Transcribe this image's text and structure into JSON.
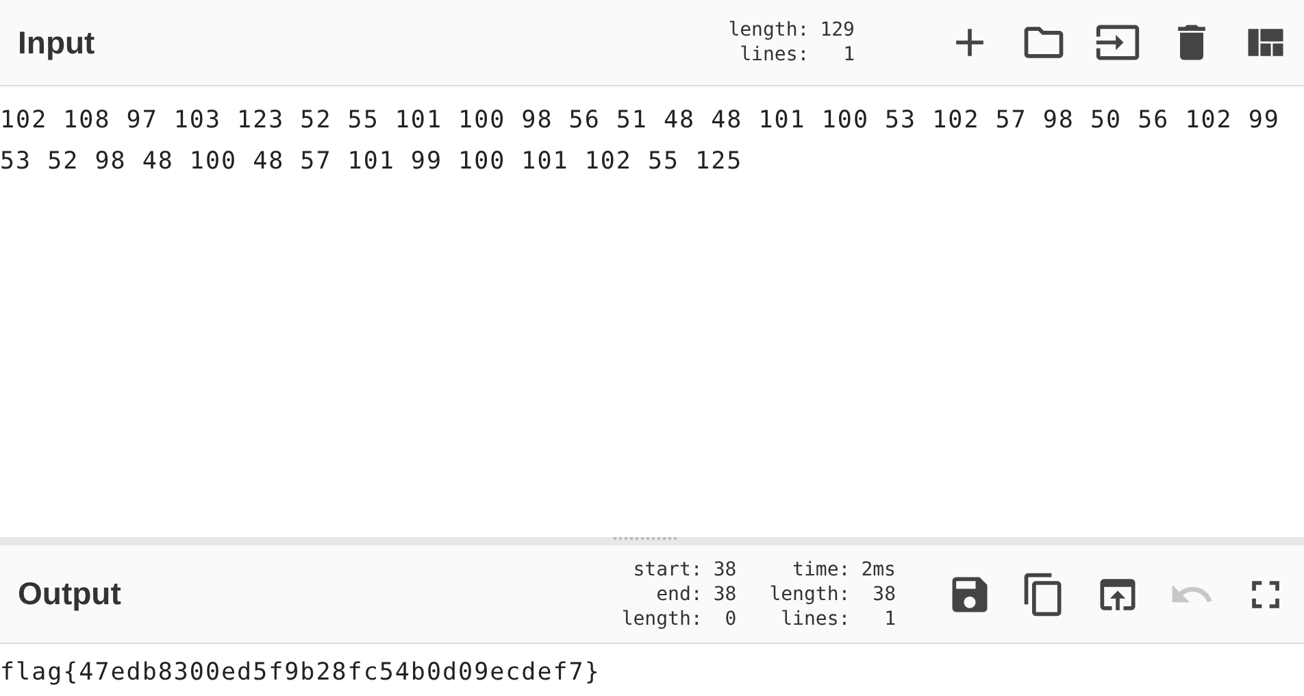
{
  "input": {
    "title": "Input",
    "stats": [
      {
        "label": "length:",
        "value": "129"
      },
      {
        "label": "lines:",
        "value": "1"
      }
    ],
    "buttons": [
      {
        "kind": "add",
        "disabled": false
      },
      {
        "kind": "open",
        "disabled": false
      },
      {
        "kind": "insert",
        "disabled": false
      },
      {
        "kind": "delete",
        "disabled": false
      },
      {
        "kind": "layout",
        "disabled": false
      }
    ],
    "text": "102 108 97 103 123 52 55 101 100 98 56 51 48 48 101 100 53 102 57 98 50 56 102 99 53 52 98 48 100 48 57 101 99 100 101 102 55 125"
  },
  "output": {
    "title": "Output",
    "stats_left": [
      {
        "label": "start:",
        "value": "38"
      },
      {
        "label": "end:",
        "value": "38"
      },
      {
        "label": "length:",
        "value": "0"
      }
    ],
    "stats_right": [
      {
        "label": "time:",
        "value": "2ms"
      },
      {
        "label": "length:",
        "value": "38"
      },
      {
        "label": "lines:",
        "value": "1"
      }
    ],
    "buttons": [
      {
        "kind": "save",
        "disabled": false
      },
      {
        "kind": "copy",
        "disabled": false
      },
      {
        "kind": "replace",
        "disabled": false
      },
      {
        "kind": "undo",
        "disabled": true
      },
      {
        "kind": "fullscreen",
        "disabled": false
      }
    ],
    "text": "flag{47edb8300ed5f9b28fc54b0d09ecdef7}"
  }
}
